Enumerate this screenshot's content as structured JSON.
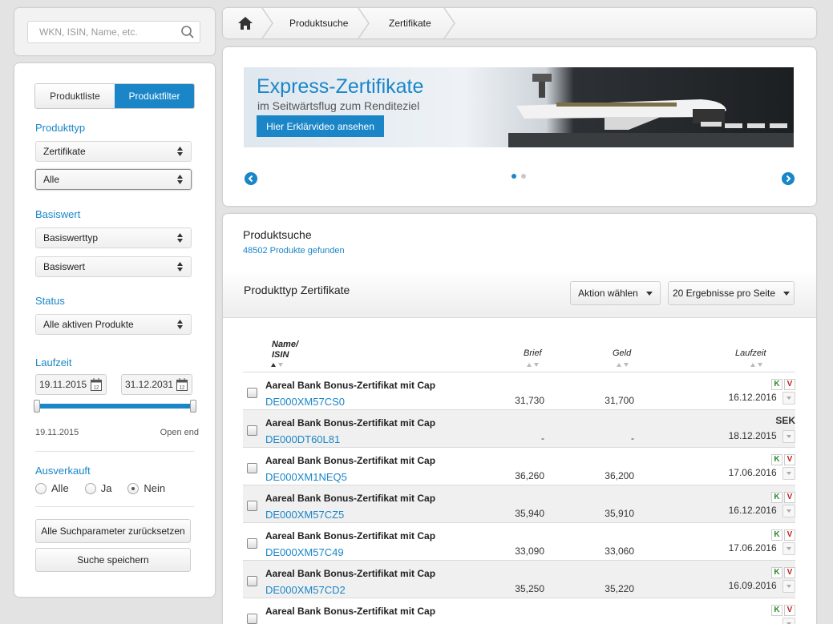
{
  "search": {
    "placeholder": "WKN, ISIN, Name, etc."
  },
  "filter": {
    "tabs": {
      "list": "Produktliste",
      "filter": "Produktfilter"
    },
    "produkttyp": {
      "label": "Produkttyp",
      "select1": "Zertifikate",
      "select2": "Alle"
    },
    "basiswert": {
      "label": "Basiswert",
      "select1": "Basiswerttyp",
      "select2": "Basiswert"
    },
    "status": {
      "label": "Status",
      "select1": "Alle aktiven Produkte"
    },
    "laufzeit": {
      "label": "Laufzeit",
      "from": "19.11.2015",
      "to": "31.12.2031",
      "min_label": "19.11.2015",
      "max_label": "Open end"
    },
    "ausverkauft": {
      "label": "Ausverkauft",
      "options": [
        "Alle",
        "Ja",
        "Nein"
      ],
      "selected": "Nein"
    },
    "reset_button": "Alle Suchparameter zurücksetzen",
    "save_button": "Suche speichern",
    "calendar_day": "12"
  },
  "breadcrumb": {
    "items": [
      "Produktsuche",
      "Zertifikate"
    ]
  },
  "banner": {
    "title": "Express-Zertifikate",
    "subtitle": "im Seitwärtsflug zum Renditeziel",
    "button": "Hier Erklärvideo ansehen",
    "active_slide": 1,
    "slide_count": 2
  },
  "results": {
    "title": "Produktsuche",
    "count": "48502 Produkte gefunden",
    "subtitle": "Produkttyp Zertifikate",
    "action_button": "Aktion wählen",
    "per_page_button": "20 Ergebnisse pro Seite",
    "columns": {
      "name": "Name/",
      "isin": "ISIN",
      "brief": "Brief",
      "geld": "Geld",
      "laufzeit": "Laufzeit"
    },
    "rows": [
      {
        "name": "Aareal Bank Bonus-Zertifikat mit Cap",
        "isin": "DE000XM57CS0",
        "brief": "31,730",
        "geld": "31,700",
        "laufzeit": "16.12.2016",
        "badge": "KV"
      },
      {
        "name": "Aareal Bank Bonus-Zertifikat mit Cap",
        "isin": "DE000DT60L81",
        "brief": "-",
        "geld": "-",
        "laufzeit": "18.12.2015",
        "badge": "SEK"
      },
      {
        "name": "Aareal Bank Bonus-Zertifikat mit Cap",
        "isin": "DE000XM1NEQ5",
        "brief": "36,260",
        "geld": "36,200",
        "laufzeit": "17.06.2016",
        "badge": "KV"
      },
      {
        "name": "Aareal Bank Bonus-Zertifikat mit Cap",
        "isin": "DE000XM57CZ5",
        "brief": "35,940",
        "geld": "35,910",
        "laufzeit": "16.12.2016",
        "badge": "KV"
      },
      {
        "name": "Aareal Bank Bonus-Zertifikat mit Cap",
        "isin": "DE000XM57C49",
        "brief": "33,090",
        "geld": "33,060",
        "laufzeit": "17.06.2016",
        "badge": "KV"
      },
      {
        "name": "Aareal Bank Bonus-Zertifikat mit Cap",
        "isin": "DE000XM57CD2",
        "brief": "35,250",
        "geld": "35,220",
        "laufzeit": "16.09.2016",
        "badge": "KV"
      },
      {
        "name": "Aareal Bank Bonus-Zertifikat mit Cap",
        "isin": "",
        "brief": "",
        "geld": "",
        "laufzeit": "",
        "badge": "KV"
      }
    ],
    "badge_k": "K",
    "badge_v": "V"
  },
  "colors": {
    "accent": "#1a86c8",
    "background": "#e3e3e3",
    "k_green": "#2a8a2a",
    "v_red": "#c62020"
  },
  "icons": {
    "search": "search-icon",
    "home": "home-icon",
    "calendar": "calendar-icon",
    "prev": "chevron-left-icon",
    "next": "chevron-right-icon"
  }
}
